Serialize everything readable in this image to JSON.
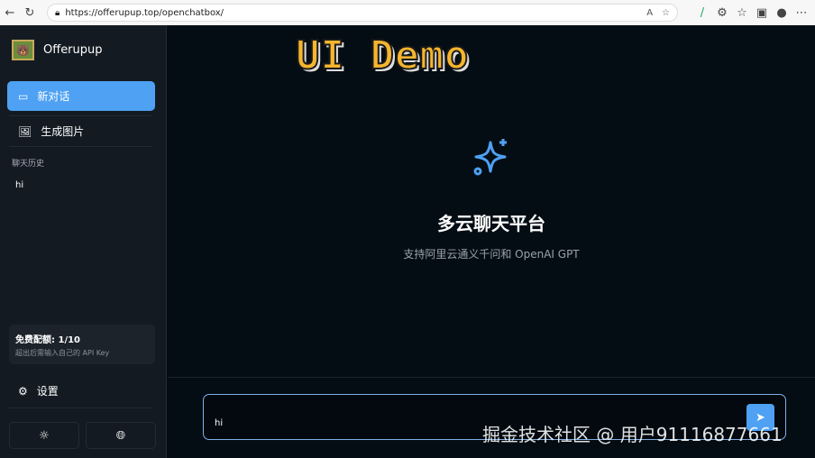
{
  "browser": {
    "url": "https://offerupup.top/openchatbox/"
  },
  "sidebar": {
    "brand": "Offerupup",
    "new_chat": "新对话",
    "gen_image": "生成图片",
    "history_label": "聊天历史",
    "history": [
      {
        "title": "hi"
      }
    ],
    "quota": {
      "title": "免费配额: 1/10",
      "note": "超出后需输入自己的 API Key"
    },
    "settings": "设置"
  },
  "overlay": {
    "demo": "UI Demo"
  },
  "main": {
    "title": "多云聊天平台",
    "subtitle": "支持阿里云通义千问和 OpenAI GPT"
  },
  "input": {
    "value": "hi"
  },
  "watermark": "掘金技术社区 @ 用户91116877661",
  "colors": {
    "accent": "#4ea1f3"
  }
}
